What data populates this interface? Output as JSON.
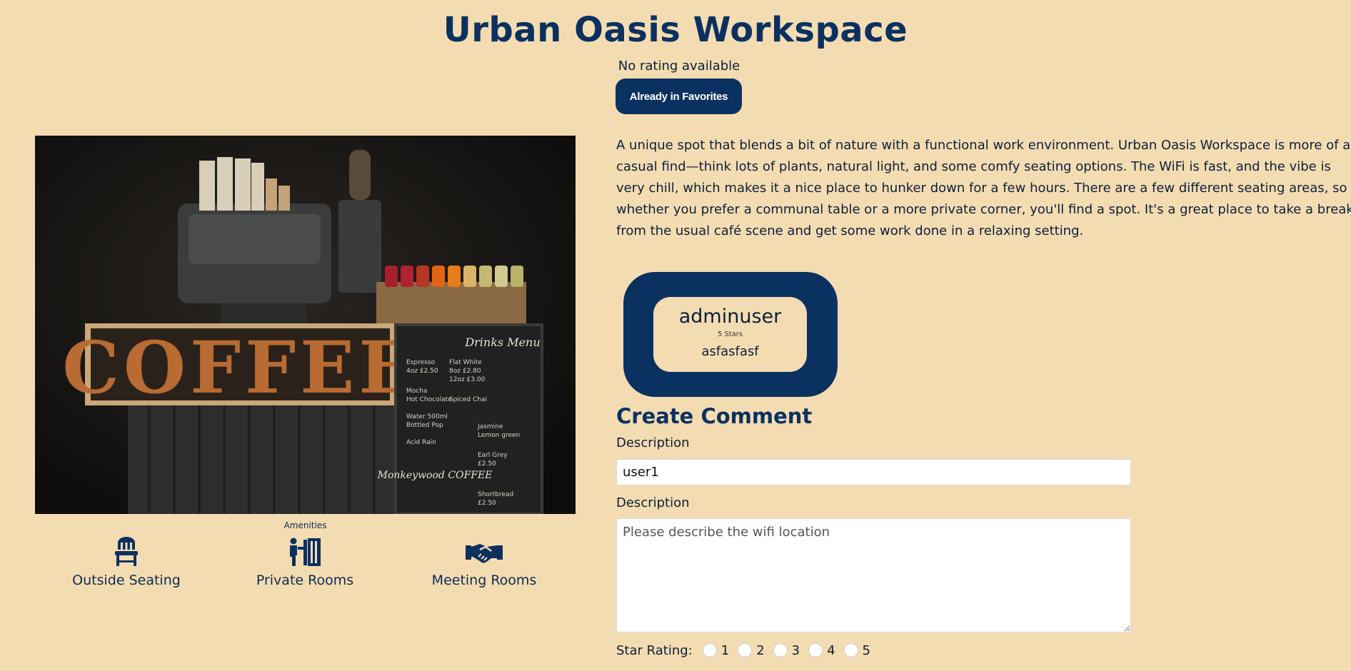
{
  "page": {
    "title": "Urban Oasis Workspace",
    "rating_text": "No rating available",
    "favorite_button": "Already in Favorites"
  },
  "photo": {
    "sign_text": "COFFEE",
    "menu_title": "Drinks Menu",
    "menu_brand": "Monkeywood COFFEE"
  },
  "amenities": {
    "heading": "Amenities",
    "items": [
      {
        "label": "Outside Seating",
        "icon": "chair-icon"
      },
      {
        "label": "Private Rooms",
        "icon": "private-room-icon"
      },
      {
        "label": "Meeting Rooms",
        "icon": "handshake-icon"
      }
    ]
  },
  "description": "A unique spot that blends a bit of nature with a functional work environment. Urban Oasis Workspace is more of a casual find—think lots of plants, natural light, and some comfy seating options. The WiFi is fast, and the vibe is very chill, which makes it a nice place to hunker down for a few hours. There are a few different seating areas, so whether you prefer a communal table or a more private corner, you'll find a spot. It's a great place to take a break from the usual café scene and get some work done in a relaxing setting.",
  "reviews": [
    {
      "user": "adminuser",
      "stars": "5 Stars",
      "body": "asfasfasf"
    }
  ],
  "comment_form": {
    "heading": "Create Comment",
    "name_label": "Description",
    "name_value": "user1",
    "description_label": "Description",
    "description_placeholder": "Please describe the wifi location",
    "star_label": "Star Rating:",
    "star_options": [
      "1",
      "2",
      "3",
      "4",
      "5"
    ]
  },
  "colors": {
    "background": "#f4dcb2",
    "primary": "#0b3160"
  }
}
